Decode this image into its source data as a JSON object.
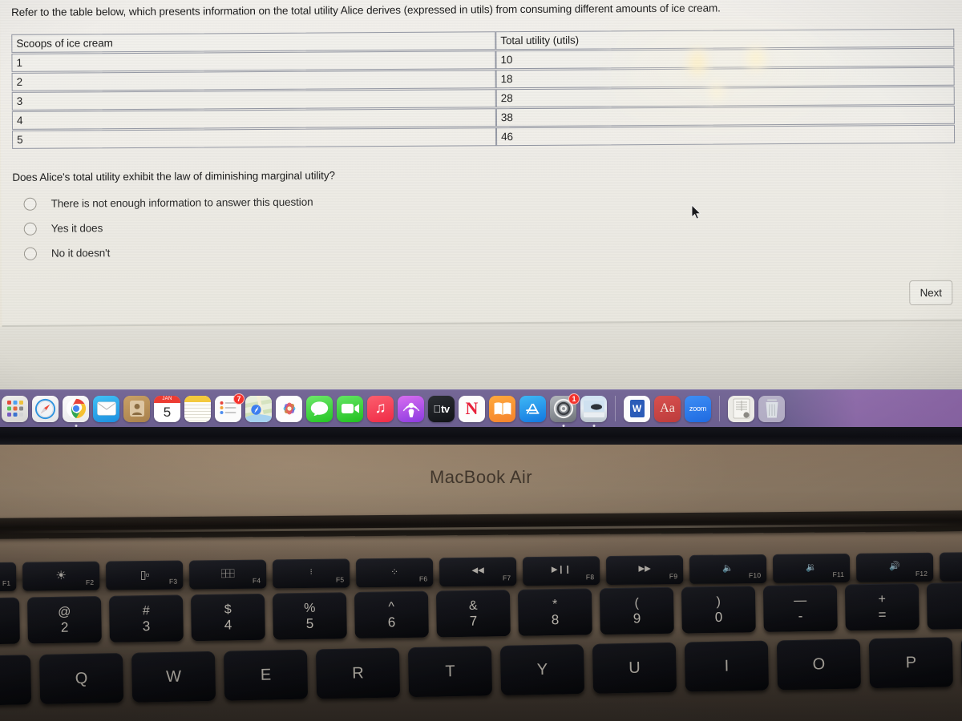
{
  "quiz": {
    "prompt": "Refer to the table below, which presents information on the total utility Alice derives (expressed in utils) from consuming different amounts of ice cream.",
    "table": {
      "headers": [
        "Scoops of ice cream",
        "Total utility (utils)"
      ],
      "rows": [
        [
          "1",
          "10"
        ],
        [
          "2",
          "18"
        ],
        [
          "3",
          "28"
        ],
        [
          "4",
          "38"
        ],
        [
          "5",
          "46"
        ]
      ]
    },
    "question": "Does Alice's total utility exhibit the law of diminishing marginal utility?",
    "options": [
      {
        "label": "There is not enough information to answer this question",
        "selected": false
      },
      {
        "label": "Yes it does",
        "selected": false
      },
      {
        "label": "No it doesn't",
        "selected": false
      }
    ],
    "next_label": "Next"
  },
  "dock": {
    "items": [
      {
        "name": "launchpad",
        "label": "Launchpad",
        "glyph": "",
        "badge": null,
        "running": false
      },
      {
        "name": "safari",
        "label": "Safari",
        "glyph": "",
        "badge": null,
        "running": false
      },
      {
        "name": "chrome",
        "label": "Google Chrome",
        "glyph": "",
        "badge": null,
        "running": true
      },
      {
        "name": "mail",
        "label": "Mail",
        "glyph": "✉",
        "badge": null,
        "running": false
      },
      {
        "name": "contacts",
        "label": "Contacts",
        "glyph": "",
        "badge": null,
        "running": false
      },
      {
        "name": "calendar",
        "label": "Calendar",
        "glyph": "5",
        "month": "JAN",
        "badge": null,
        "running": false
      },
      {
        "name": "notes",
        "label": "Notes",
        "glyph": "",
        "badge": null,
        "running": false
      },
      {
        "name": "reminders",
        "label": "Reminders",
        "glyph": "",
        "badge": "7",
        "running": false
      },
      {
        "name": "maps",
        "label": "Maps",
        "glyph": "",
        "badge": null,
        "running": false
      },
      {
        "name": "photos",
        "label": "Photos",
        "glyph": "",
        "badge": null,
        "running": false
      },
      {
        "name": "messages",
        "label": "Messages",
        "glyph": "",
        "badge": null,
        "running": false
      },
      {
        "name": "facetime",
        "label": "FaceTime",
        "glyph": "",
        "badge": null,
        "running": false
      },
      {
        "name": "music",
        "label": "Music",
        "glyph": "♫",
        "badge": null,
        "running": false
      },
      {
        "name": "podcasts",
        "label": "Podcasts",
        "glyph": "",
        "badge": null,
        "running": false
      },
      {
        "name": "appletv",
        "label": "Apple TV",
        "glyph": "tv",
        "badge": null,
        "running": false
      },
      {
        "name": "news",
        "label": "News",
        "glyph": "N",
        "badge": null,
        "running": false
      },
      {
        "name": "books",
        "label": "Books",
        "glyph": "",
        "badge": null,
        "running": false
      },
      {
        "name": "appstore",
        "label": "App Store",
        "glyph": "A",
        "badge": null,
        "running": false
      },
      {
        "name": "system-settings",
        "label": "System Settings",
        "glyph": "",
        "badge": "1",
        "running": true
      },
      {
        "name": "system-preferences",
        "label": "Preferences",
        "glyph": "",
        "badge": null,
        "running": true
      },
      {
        "name": "microsoft-word",
        "label": "Microsoft Word",
        "glyph": "W",
        "badge": null,
        "running": false
      },
      {
        "name": "dictionary",
        "label": "Dictionary",
        "glyph": "Aa",
        "badge": null,
        "running": false
      },
      {
        "name": "zoom",
        "label": "zoom",
        "glyph": "zoom",
        "badge": null,
        "running": false
      },
      {
        "name": "document-file",
        "label": "Document",
        "glyph": "",
        "badge": null,
        "running": false
      },
      {
        "name": "trash",
        "label": "Trash",
        "glyph": "",
        "badge": null,
        "running": false
      }
    ]
  },
  "laptop": {
    "model_label": "MacBook Air"
  },
  "keyboard": {
    "function_row": [
      {
        "key": "F1",
        "glyph": "☼",
        "action": "brightness-down"
      },
      {
        "key": "F2",
        "glyph": "☀",
        "action": "brightness-up"
      },
      {
        "key": "F3",
        "glyph": "⊟",
        "action": "mission-control"
      },
      {
        "key": "F4",
        "glyph": "⣿",
        "action": "launchpad"
      },
      {
        "key": "F5",
        "glyph": "⁙",
        "action": "keyboard-backlight-down"
      },
      {
        "key": "F6",
        "glyph": "⁘",
        "action": "keyboard-backlight-up"
      },
      {
        "key": "F7",
        "glyph": "◀◀",
        "action": "rewind"
      },
      {
        "key": "F8",
        "glyph": "▶❙❙",
        "action": "play-pause"
      },
      {
        "key": "F9",
        "glyph": "▶▶",
        "action": "fast-forward"
      },
      {
        "key": "F10",
        "glyph": "🔇",
        "action": "mute"
      },
      {
        "key": "F11",
        "glyph": "🔉",
        "action": "volume-down"
      },
      {
        "key": "F12",
        "glyph": "🔊",
        "action": "volume-up"
      }
    ],
    "number_row": [
      {
        "top": "@",
        "bottom": "2"
      },
      {
        "top": "#",
        "bottom": "3"
      },
      {
        "top": "$",
        "bottom": "4"
      },
      {
        "top": "%",
        "bottom": "5"
      },
      {
        "top": "^",
        "bottom": "6"
      },
      {
        "top": "&",
        "bottom": "7"
      },
      {
        "top": "*",
        "bottom": "8"
      },
      {
        "top": "(",
        "bottom": "9"
      },
      {
        "top": ")",
        "bottom": "0"
      },
      {
        "top": "—",
        "bottom": "-"
      },
      {
        "top": "+",
        "bottom": "="
      }
    ],
    "letter_row": [
      "W",
      "E",
      "R",
      "T",
      "Y",
      "U",
      "I",
      "O",
      "P",
      "{"
    ]
  },
  "colors": {
    "dock_background": "#7b6ea0",
    "panel_background": "#efedE7",
    "table_border": "#9397a3",
    "body_gold": "#8a7560",
    "key_black": "#16171d"
  }
}
